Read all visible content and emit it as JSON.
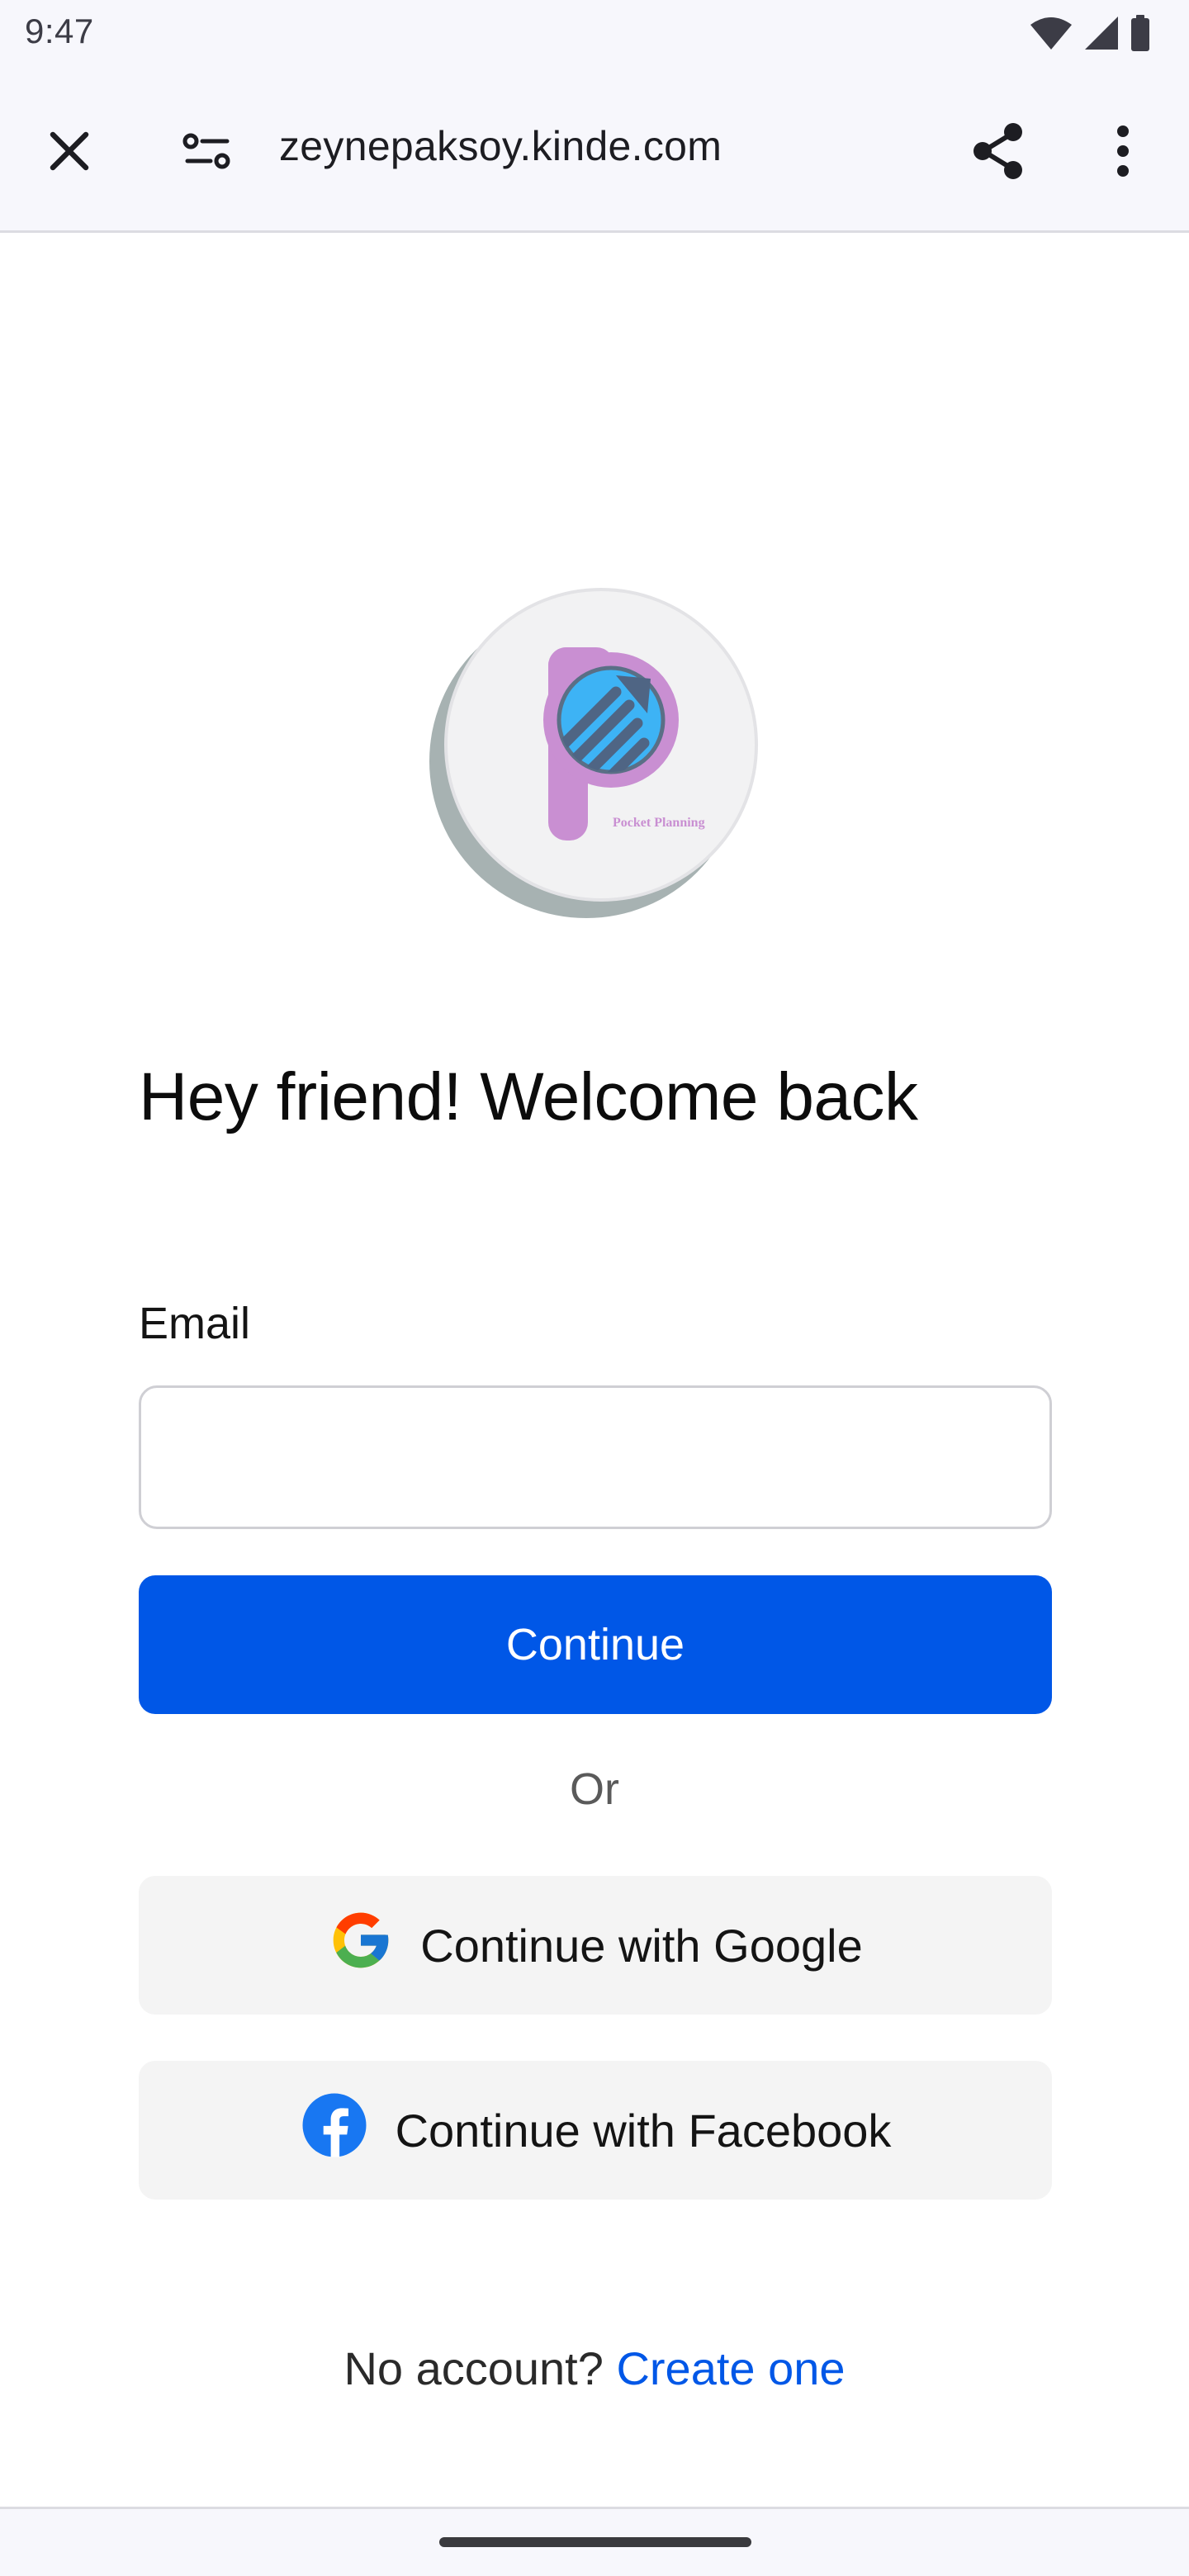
{
  "status_bar": {
    "time": "9:47",
    "icons": [
      "wifi-icon",
      "cellular-signal-icon",
      "battery-icon"
    ]
  },
  "toolbar": {
    "url": "zeynepaksoy.kinde.com",
    "close_icon": "close-icon",
    "site_info_icon": "site-settings-icon",
    "share_icon": "share-icon",
    "menu_icon": "more-vert-icon"
  },
  "logo": {
    "caption": "Pocket Planning"
  },
  "heading": "Hey friend! Welcome back",
  "form": {
    "email_label": "Email",
    "email_value": "",
    "email_placeholder": "",
    "continue_label": "Continue"
  },
  "divider_text": "Or",
  "social": {
    "google_label": "Continue with Google",
    "facebook_label": "Continue with Facebook"
  },
  "signup": {
    "prompt": "No account?",
    "link_label": "Create one"
  },
  "colors": {
    "primary": "#0057e7",
    "logo_pink": "#c98fd2",
    "logo_blue": "#3db3f5"
  }
}
